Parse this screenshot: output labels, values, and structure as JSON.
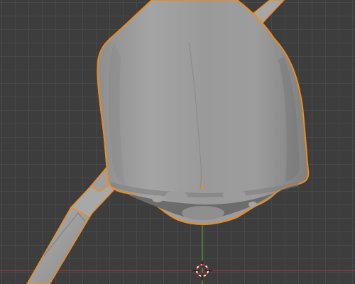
{
  "viewport": {
    "mode": "3d-viewport",
    "grid_visible": true,
    "selected_object_outline_color": "#f08a1e",
    "x_axis_color": "#8e3a3a",
    "y_axis_color": "#5d8f2a",
    "mesh_color": "#9a9a9a",
    "background_color": "#3d3d3d"
  },
  "icons": {
    "cursor": "3d-cursor-icon",
    "origin": "object-origin-icon"
  }
}
